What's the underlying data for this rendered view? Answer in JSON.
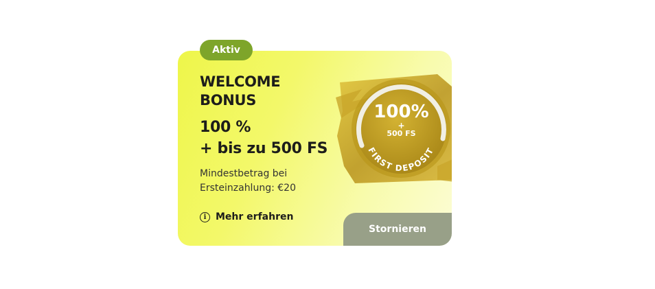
{
  "badge": {
    "label": "Aktiv"
  },
  "bonus": {
    "title_line1": "WELCOME",
    "title_line2": "BONUS",
    "offer_line1": "100 %",
    "offer_line2": "+ bis zu 500 FS",
    "min_line1": "Mindestbetrag bei",
    "min_line2": "Ersteinzahlung: €20",
    "more_label": "Mehr erfahren",
    "info_icon": "i",
    "cancel_label": "Stornieren"
  },
  "emblem": {
    "percent": "100%",
    "plus": "+",
    "fs": "500 FS",
    "arc_text": "FIRST DEPOSIT"
  },
  "colors": {
    "badge": "#7ea52a",
    "cancel": "#98a088",
    "gold": "#c8a623"
  }
}
